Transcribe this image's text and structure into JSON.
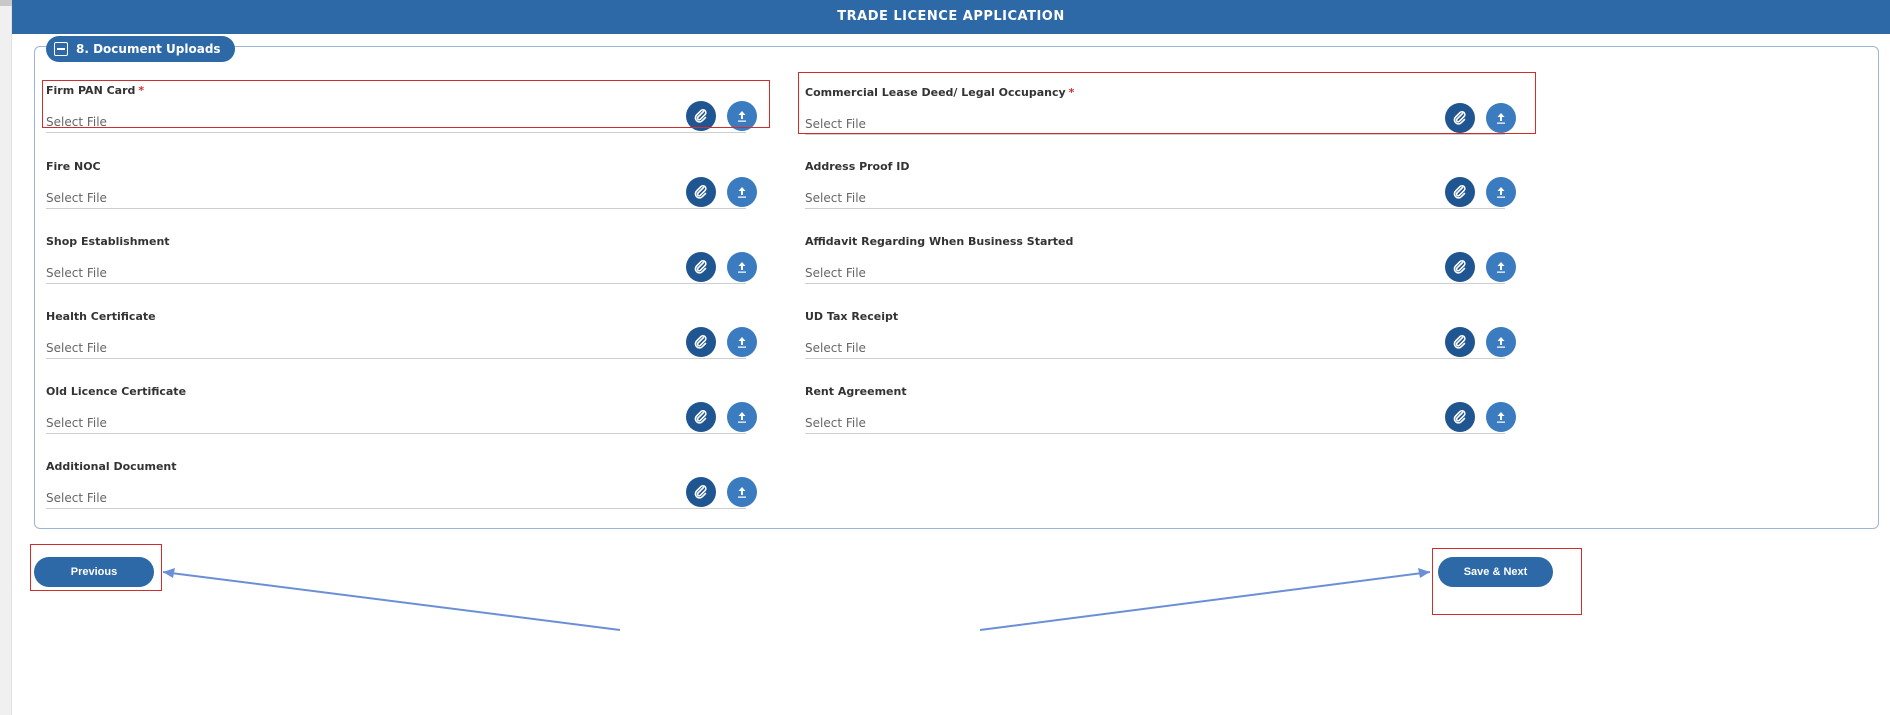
{
  "header": {
    "title": "TRADE LICENCE APPLICATION"
  },
  "section": {
    "title": "8. Document Uploads"
  },
  "placeholder": "Select File",
  "fields": [
    {
      "label": "Firm PAN Card",
      "required": "*"
    },
    {
      "label": "Commercial Lease Deed/ Legal Occupancy",
      "required": "*"
    },
    {
      "label": "Fire NOC",
      "required": ""
    },
    {
      "label": "Address Proof ID",
      "required": ""
    },
    {
      "label": "Shop Establishment",
      "required": ""
    },
    {
      "label": "Affidavit Regarding When Business Started",
      "required": ""
    },
    {
      "label": "Health Certificate",
      "required": ""
    },
    {
      "label": "UD Tax Receipt",
      "required": ""
    },
    {
      "label": "Old Licence Certificate",
      "required": ""
    },
    {
      "label": "Rent Agreement",
      "required": ""
    },
    {
      "label": "Additional Document",
      "required": ""
    }
  ],
  "buttons": {
    "previous": "Previous",
    "save_next": "Save & Next"
  },
  "icons": {
    "attach": "paperclip-icon",
    "upload": "upload-icon",
    "collapse": "collapse-icon"
  },
  "colors": {
    "primary": "#2d69a6",
    "required": "#d32f2f",
    "highlight": "#d02d2d",
    "arrow": "#6b8fd6"
  }
}
